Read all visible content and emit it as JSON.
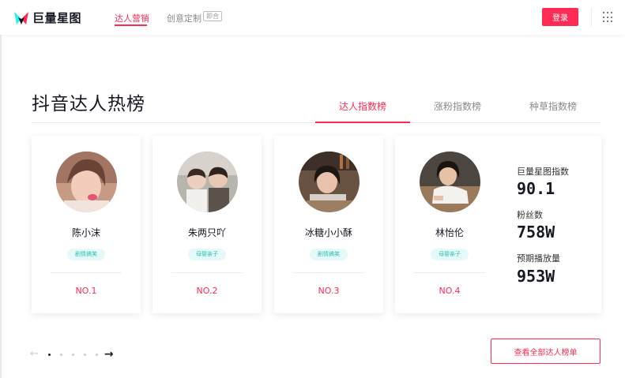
{
  "header": {
    "logo_text": "巨量星图",
    "nav": [
      {
        "label": "达人营销"
      },
      {
        "label": "创意定制",
        "badge": "即合"
      }
    ],
    "login_label": "登录"
  },
  "section": {
    "title": "抖音达人热榜",
    "tabs": [
      {
        "label": "达人指数榜",
        "active": true
      },
      {
        "label": "涨粉指数榜",
        "active": false
      },
      {
        "label": "种草指数榜",
        "active": false
      }
    ]
  },
  "cards": [
    {
      "name": "陈小沫",
      "tag": "剧情搞笑",
      "rank": "NO.1"
    },
    {
      "name": "朱两只吖",
      "tag": "母婴亲子",
      "rank": "NO.2"
    },
    {
      "name": "冰糖小小酥",
      "tag": "剧情搞笑",
      "rank": "NO.3"
    },
    {
      "name": "林怡伦",
      "tag": "母婴亲子",
      "rank": "NO.4",
      "stats": [
        {
          "label": "巨量星图指数",
          "value": "90.1"
        },
        {
          "label": "粉丝数",
          "value": "758W"
        },
        {
          "label": "预期播放量",
          "value": "953W"
        }
      ]
    }
  ],
  "pagination": {
    "current": 1,
    "total": 5
  },
  "view_all_label": "查看全部达人榜单",
  "colors": {
    "accent": "#fe2c55",
    "tag_bg": "#e4f9f8",
    "tag_text": "#2fbdb5",
    "logo_cyan": "#25f4ee"
  }
}
